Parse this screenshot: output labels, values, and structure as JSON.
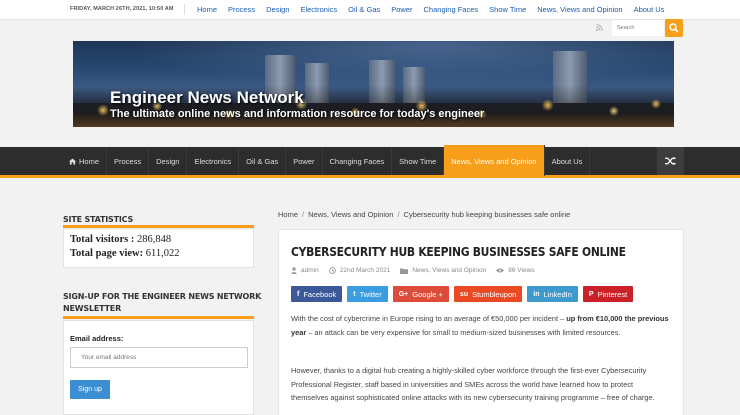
{
  "topbar": {
    "date": "FRIDAY, MARCH 26TH, 2021, 10:50 AM",
    "links": [
      "Home",
      "Process",
      "Design",
      "Electronics",
      "Oil & Gas",
      "Power",
      "Changing Faces",
      "Show Time",
      "News, Views and Opinion",
      "About Us"
    ]
  },
  "search": {
    "placeholder": "Search"
  },
  "banner": {
    "title": "Engineer News Network",
    "subtitle": "The ultimate online news and information resource for today's engineer"
  },
  "mainnav": {
    "items": [
      "Home",
      "Process",
      "Design",
      "Electronics",
      "Oil & Gas",
      "Power",
      "Changing Faces",
      "Show Time",
      "News, Views and Opinion",
      "About Us"
    ],
    "active": "News, Views and Opinion"
  },
  "sidebar": {
    "stats_title": "SITE STATISTICS",
    "visitors_label": "Total visitors :",
    "visitors_value": "286,848",
    "pageviews_label": "Total page view:",
    "pageviews_value": "611,022",
    "signup_title": "SIGN-UP FOR THE ENGINEER NEWS NETWORK NEWSLETTER",
    "email_label": "Email address:",
    "email_placeholder": "Your email address",
    "signup_button": "Sign up"
  },
  "breadcrumb": [
    "Home",
    "News, Views and Opinion",
    "Cybersecurity hub keeping businesses safe online"
  ],
  "article": {
    "title": "CYBERSECURITY HUB KEEPING BUSINESSES SAFE ONLINE",
    "author": "admin",
    "date": "22nd March 2021",
    "category": "News, Views and Opinion",
    "views": "86 Views",
    "p1_start": "With the cost of cybercrime in Europe rising to an average of €50,000 per incident – ",
    "p1_bold": "up from €10,000 the previous year",
    "p1_end": " – an attack can be very expensive for small to medium-sized businesses with limited resources.",
    "p2": "However, thanks to a digital hub creating a highly-skilled cyber workforce through the first-ever Cybersecurity Professional Register, staff based in universities and SMEs across the world have learned how to protect themselves against sophisticated online attacks with its new cybersecurity training programme – free of charge."
  },
  "shares": [
    {
      "label": "Facebook",
      "icon": "f",
      "color": "#3b5998"
    },
    {
      "label": "Twitter",
      "icon": "t",
      "color": "#3b9de1"
    },
    {
      "label": "Google +",
      "icon": "G+",
      "color": "#dd4b39"
    },
    {
      "label": "Stumbleupon",
      "icon": "su",
      "color": "#eb4924"
    },
    {
      "label": "LinkedIn",
      "icon": "in",
      "color": "#3e9acd"
    },
    {
      "label": "Pinterest",
      "icon": "P",
      "color": "#cb2027"
    }
  ],
  "colors": {
    "accent": "#f79e1b",
    "nav_bg": "#2d2d2d",
    "link": "#1a5db5"
  }
}
